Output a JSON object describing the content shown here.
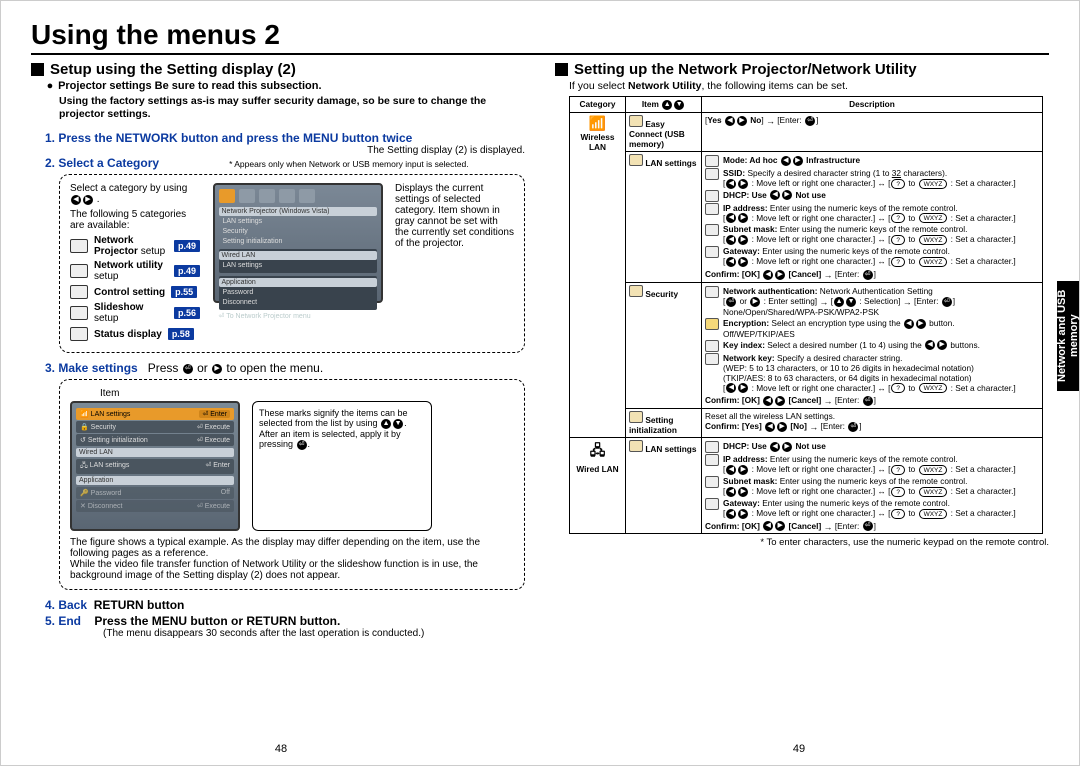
{
  "title": "Using the menus 2",
  "left": {
    "h2": "Setup using the Setting display (2)",
    "sub_bullet": "Projector settings Be sure to read this subsection.",
    "warn": "Using the factory settings as-is may suffer security damage, so be sure to change the projector settings.",
    "step1": "1. Press the NETWORK button and press the MENU button twice",
    "step1_note": "The Setting display (2) is displayed.",
    "step2": "2. Select a Category",
    "step2_star": "* Appears only when Network or USB memory input is selected.",
    "selcat_intro1": "Select a category by using",
    "selcat_intro2": "The following 5 categories are available:",
    "categories": [
      {
        "label": "Network Projector",
        "sub": "setup",
        "page": "p.49"
      },
      {
        "label": "Network utility",
        "sub": "setup",
        "page": "p.49"
      },
      {
        "label": "Control setting",
        "sub": "",
        "page": "p.55"
      },
      {
        "label": "Slideshow",
        "sub": "setup",
        "page": "p.56"
      },
      {
        "label": "Status display",
        "sub": "",
        "page": "p.58"
      }
    ],
    "right_of_osd": "Displays the current settings of selected category. Item shown in gray cannot be set with the currently set conditions of the projector.",
    "step3_pre": "3. Make settings",
    "step3_rest": "Press      or      to open the menu.",
    "item_label": "Item",
    "callout": "These marks signify the items can be selected from the list by using      .\nAfter an item is selected, apply it by pressing     .",
    "dash2_p1": "The figure shows a typical example. As the display may differ depending on the item, use the following pages as a reference.",
    "dash2_p2": "While the video file transfer function of Network Utility or the slideshow function is in use, the background image of the Setting display (2) does not appear.",
    "step4_a": "4. Back",
    "step4_b": "RETURN button",
    "step5_a": "5. End",
    "step5_b": "Press the MENU button or RETURN button.",
    "end_note": "(The menu disappears 30 seconds after the last operation is conducted.)",
    "osd": {
      "header": "Network Projector (Windows Vista)",
      "rows": [
        "LAN settings",
        "Security",
        "Setting initialization"
      ],
      "sub_header": "Wired LAN",
      "sub_rows": [
        "LAN settings"
      ],
      "app_header": "Application",
      "app_rows": [
        "Password",
        "Disconnect"
      ],
      "footer": "To Network Projector menu"
    },
    "osd2_rows": [
      {
        "l": "LAN settings",
        "r": "Enter",
        "sel": true
      },
      {
        "l": "Security",
        "r": "Execute",
        "sel": false
      },
      {
        "l": "Setting initialization",
        "r": "Execute",
        "sel": false
      },
      {
        "l": "Wired LAN",
        "r": "",
        "sel": false,
        "hdr": true
      },
      {
        "l": "LAN settings",
        "r": "Enter",
        "sel": false
      },
      {
        "l": "Application",
        "r": "",
        "sel": false,
        "hdr": true
      },
      {
        "l": "Password",
        "r": "Off",
        "sel": false
      },
      {
        "l": "Disconnect",
        "r": "Execute",
        "sel": false
      }
    ]
  },
  "right": {
    "h2": "Setting up the Network Projector/Network Utility",
    "intro_a": "If you select ",
    "intro_b": "Network Utility",
    "intro_c": ", the following items can be set.",
    "table_headers": {
      "c1": "Category",
      "c2": "Item",
      "c3": "Description"
    },
    "wlan_label": "Wireless LAN",
    "wired_label": "Wired LAN",
    "items": {
      "easy": "Easy Connect (USB memory)",
      "lan": "LAN settings",
      "security": "Security",
      "init": "Setting initialization"
    },
    "desc": {
      "easy": "[Yes     No] → [Enter:   ]",
      "mode": "Mode: Ad hoc     Infrastructure",
      "ssid_a": "SSID: Specify a desired character string (1 to 32 characters).",
      "nav": "     : Move left or right one character.] ↔ [    to     : Set a character.]",
      "dhcp": "DHCP: Use     Not use",
      "ip": "IP address: Enter using the numeric keys of the remote control.",
      "subnet": "Subnet mask: Enter using the numeric keys of the remote control.",
      "gateway": "Gateway: Enter using the numeric keys of the remote control.",
      "confirm_okcancel": "Confirm: [OK]     [Cancel] → [Enter:   ]",
      "netauth_a": "Network authentication: Network Authentication Setting",
      "netauth_b": "[   or   : Enter setting] → [      : Selection] → [Enter:   ]",
      "netauth_c": "None/Open/Shared/WPA-PSK/WPA2-PSK",
      "encr_a": "Encryption: Select an encryption type using the      button.",
      "encr_b": "Off/WEP/TKIP/AES",
      "keyidx": "Key index: Select a desired number (1 to 4) using the      buttons.",
      "netkey_a": "Network key: Specify a desired character string.",
      "netkey_b": "(WEP: 5 to 13 characters, or 10 to 26 digits in hexadecimal notation)",
      "netkey_c": "(TKIP/AES: 8 to 63 characters, or 64 digits in hexadecimal notation)",
      "reset": "Reset all the wireless LAN settings.",
      "confirm_yesno": "Confirm: [Yes]     [No] → [Enter:   ]"
    },
    "foot": "* To enter characters, use the numeric keypad on the remote control.",
    "sidetab": "Network and USB memory"
  },
  "pages": {
    "left": "48",
    "right": "49"
  }
}
